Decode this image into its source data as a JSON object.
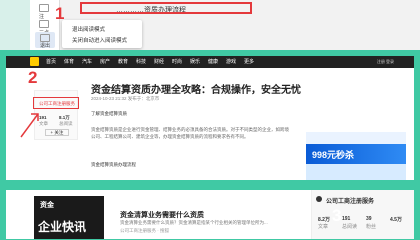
{
  "step1": {
    "number": "1",
    "title_text": "…………资质办理流程",
    "leftbar": {
      "item_a": "注",
      "item_b": "三点",
      "item_c": "退出"
    },
    "menu": {
      "item1": "退出阅读模式",
      "item2": "关闭自动进入阅读模式"
    }
  },
  "step2": {
    "number": "2",
    "nav_items": [
      "首页",
      "体育",
      "汽车",
      "房产",
      "教育",
      "科技",
      "财经",
      "时尚",
      "娱乐",
      "健康",
      "游戏",
      "更多"
    ],
    "nav_login": "注册 登录",
    "author_name": "公司工商注册服务",
    "author_stats": {
      "a_val": "191",
      "a_label": "文章",
      "b_val": "8.1万",
      "b_label": "总阅读"
    },
    "author_follow": "+ 关注",
    "article_title": "资金结算资质办理全攻略：合规操作，安全无忧",
    "article_meta": "2024-10-23 21:32 发布于：北京市",
    "article_intro": "了解资金结算资质",
    "article_para": "资金结算资质是企业进行资金管理、结算业务的必须具备的合法资质。对于不同类型的企业，如跨境公司、工程结算公司、建筑企业等，办理资金结算资质的流程和要求各有不同。",
    "article_link": "资金结算资质办理流程",
    "ad_text": "998元秒杀"
  },
  "step3": {
    "number": "3",
    "thumb_line1": "企业快讯",
    "thumb_line2": "资金",
    "list_title": "资金清算业务需要什么资质",
    "list_desc": "资金清算业务需要什么资质？资金清算是指某个行业相关的管理单位所为...",
    "list_meta": "公司工商注册服务 · 搜狐",
    "side_title": "公司工商注册服务",
    "side_stats": [
      {
        "val": "8.2万",
        "label": "文章"
      },
      {
        "val": "191",
        "label": "总阅读"
      },
      {
        "val": "39",
        "label": "粉丝"
      },
      {
        "val": "4.5万",
        "label": ""
      }
    ]
  }
}
